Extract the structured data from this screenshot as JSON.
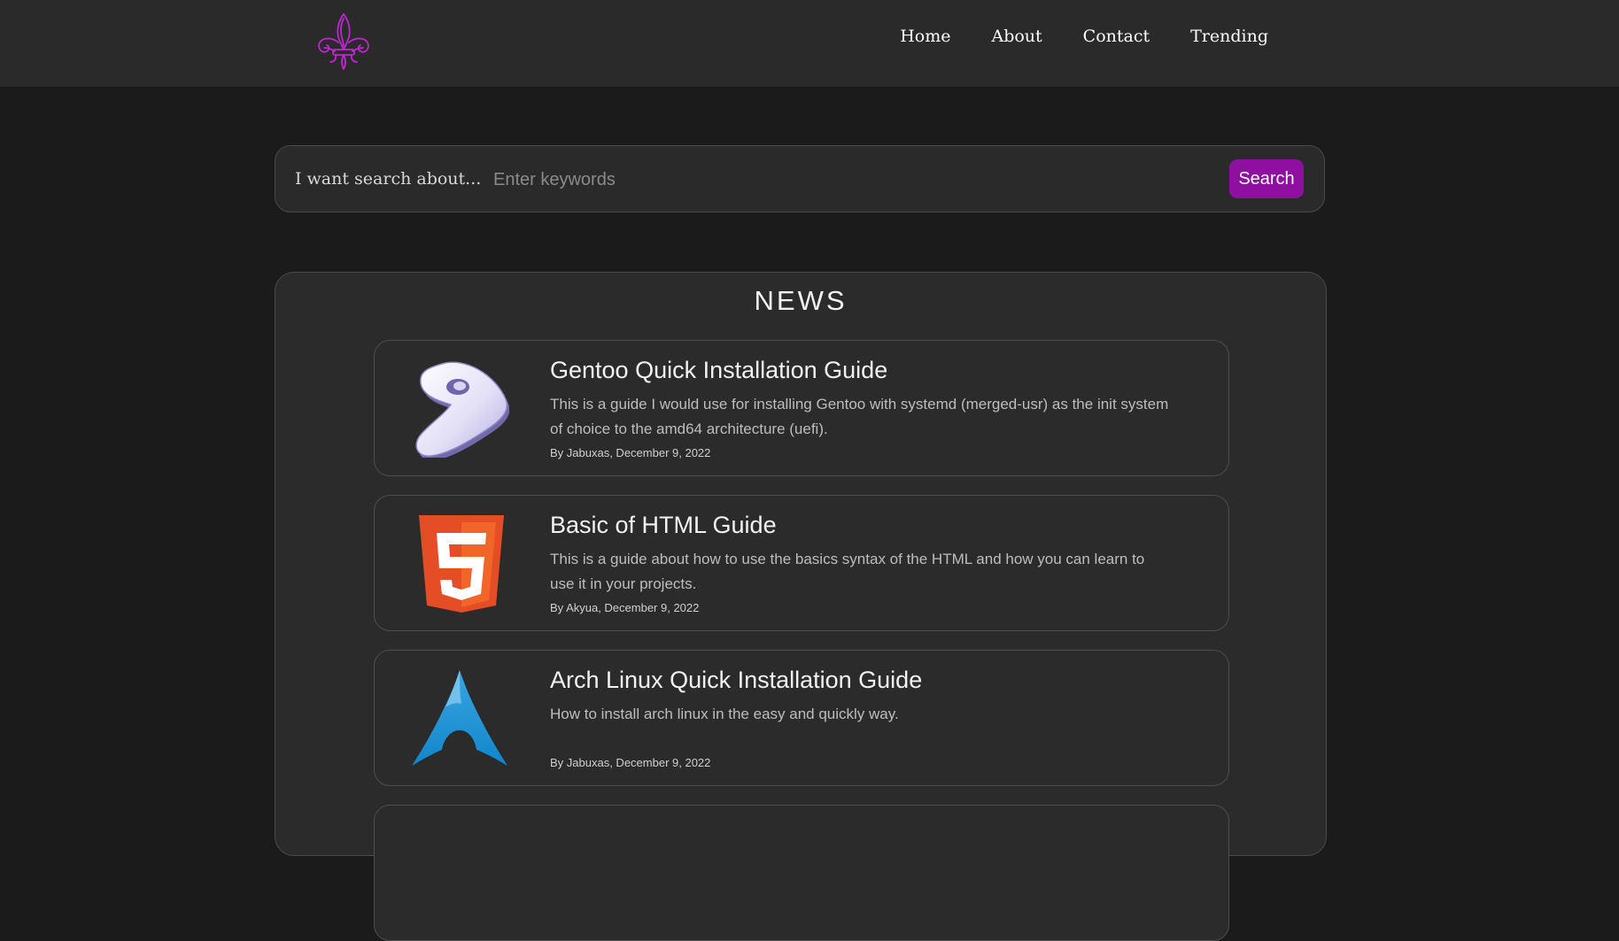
{
  "header": {
    "logo": "fleur-de-lis-logo",
    "nav": [
      "Home",
      "About",
      "Contact",
      "Trending"
    ]
  },
  "search": {
    "label": "I want search about...",
    "placeholder": "Enter keywords",
    "value": "",
    "button": "Search"
  },
  "news": {
    "title": "NEWS",
    "articles": [
      {
        "icon": "gentoo-icon",
        "title": "Gentoo Quick Installation Guide",
        "description": "This is a guide I would use for installing Gentoo with systemd (merged-usr) as the init system of choice to the amd64 architecture (uefi).",
        "meta": "By Jabuxas, December 9, 2022"
      },
      {
        "icon": "html5-icon",
        "title": "Basic of HTML Guide",
        "description": "This is a guide about how to use the basics syntax of the HTML and how you can learn to use it in your projects.",
        "meta": "By Akyua, December 9, 2022"
      },
      {
        "icon": "arch-linux-icon",
        "title": "Arch Linux Quick Installation Guide",
        "description": "How to install arch linux in the easy and quickly way.",
        "meta": "By Jabuxas, December 9, 2022"
      }
    ]
  },
  "colors": {
    "background": "#1b1b1b",
    "header": "#2a2a2a",
    "accent": "#8e0fa0",
    "logo": "#c026d3"
  }
}
